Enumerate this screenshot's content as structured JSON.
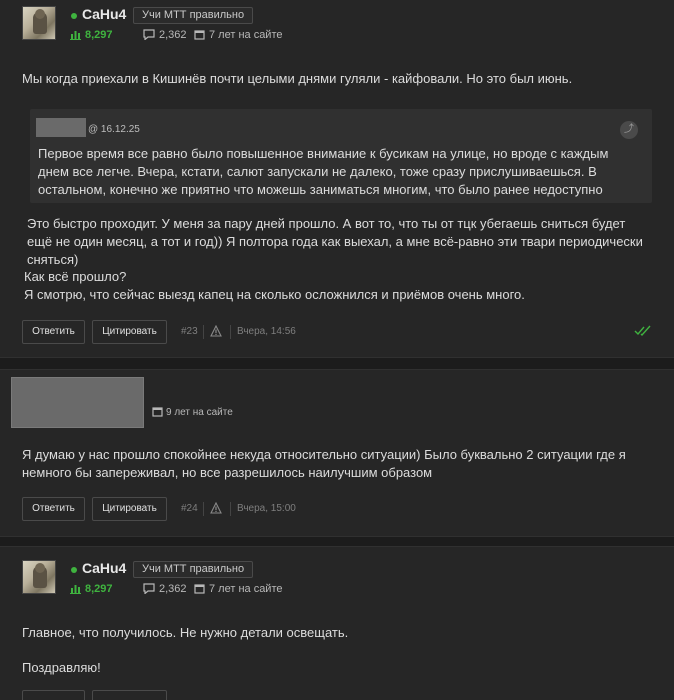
{
  "posts": [
    {
      "author": {
        "name": "CaHu4",
        "title_badge": "Учи МТТ правильно",
        "reputation": "8,297",
        "messages": "2,362",
        "on_site": "7 лет на сайте"
      },
      "intro": "Мы когда приехали в Кишинёв почти целыми днями гуляли - кайфовали. Но это был июнь.",
      "quote": {
        "author_hidden": true,
        "date": "@ 16.12.25",
        "text": " Первое время все равно было повышенное внимание к бусикам на улице, но вроде с каждым днем все легче. Вчера, кстати, салют запускали не далеко, тоже сразу прислушиваешься. В остальном, конечно же приятно что можешь заниматься многим, что было ранее недоступно"
      },
      "paragraph_1": " Это быстро проходит. У меня за пару дней прошло. А вот то, что ты от тцк убегаешь сниться будет ещё не один месяц, а тот и год)) Я полтора года как выехал, а мне всё-равно эти твари периодически сняться)",
      "paragraph_2_line_1": "Как всё прошло?",
      "paragraph_2_line_2": "Я смотрю, что сейчас выезд капец на сколько осложнился и приёмов очень много.",
      "actions": {
        "reply": "Ответить",
        "quote": "Цитировать",
        "number": "#23",
        "time": "Вчера, 14:56"
      }
    },
    {
      "guest_on_site": "9 лет на сайте",
      "text": "Я думаю у нас прошло спокойнее некуда относительно ситуации) Было буквально 2 ситуации где я немного бы запереживал, но все разрешилось наилучшим образом",
      "actions": {
        "reply": "Ответить",
        "quote": "Цитировать",
        "number": "#24",
        "time": "Вчера, 15:00"
      }
    },
    {
      "author": {
        "name": "CaHu4",
        "title_badge": "Учи МТТ правильно",
        "reputation": "8,297",
        "messages": "2,362",
        "on_site": "7 лет на сайте"
      },
      "text_1": "Главное, что получилось. Не нужно детали освещать.",
      "text_2": "Поздравляю!"
    }
  ],
  "colors": {
    "background": "#1c1c1c",
    "post_background": "#262626",
    "quote_background": "#303030",
    "online": "#3fb33f",
    "reputation": "#3fb33f",
    "read_check": "#3fb33f"
  },
  "icons": [
    "reputation-icon",
    "messages-icon",
    "calendar-icon",
    "warning-icon",
    "read-check-icon",
    "quote-jump-icon"
  ]
}
